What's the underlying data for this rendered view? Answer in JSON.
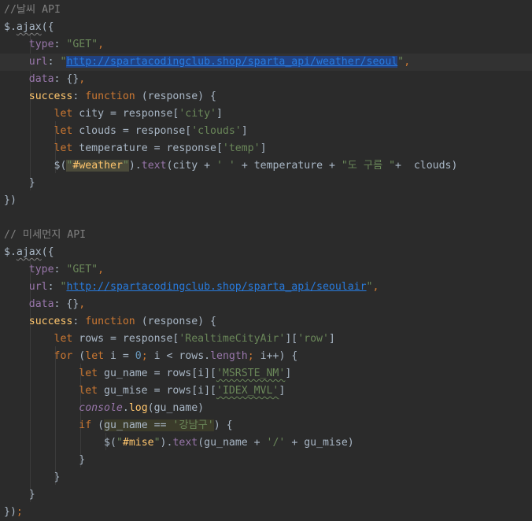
{
  "code": {
    "lines": [
      [
        {
          "t": "//날씨 API",
          "c": "comment"
        }
      ],
      [
        {
          "t": "$.",
          "c": "plain"
        },
        {
          "t": "ajax",
          "c": "plain squig-plain"
        },
        {
          "t": "({",
          "c": "plain"
        }
      ],
      [
        {
          "t": "    ",
          "c": "plain"
        },
        {
          "t": "type",
          "c": "prop"
        },
        {
          "t": ": ",
          "c": "plain"
        },
        {
          "t": "\"GET\"",
          "c": "str"
        },
        {
          "t": ",",
          "c": "kw"
        }
      ],
      [
        {
          "t": "    ",
          "c": "plain"
        },
        {
          "t": "url",
          "c": "prop"
        },
        {
          "t": ": ",
          "c": "plain"
        },
        {
          "t": "\"",
          "c": "str"
        },
        {
          "t": "http://spartacodingclub.shop/sparta_api/weather/seoul",
          "c": "url selected"
        },
        {
          "t": "\"",
          "c": "str"
        },
        {
          "t": ",",
          "c": "kw"
        }
      ],
      [
        {
          "t": "    ",
          "c": "plain"
        },
        {
          "t": "data",
          "c": "prop"
        },
        {
          "t": ": {}",
          "c": "plain"
        },
        {
          "t": ",",
          "c": "kw"
        }
      ],
      [
        {
          "t": "    ",
          "c": "plain"
        },
        {
          "t": "success",
          "c": "succ"
        },
        {
          "t": ": ",
          "c": "plain"
        },
        {
          "t": "function",
          "c": "kw"
        },
        {
          "t": " (response) {",
          "c": "plain"
        }
      ],
      [
        {
          "t": "        ",
          "c": "plain"
        },
        {
          "t": "let",
          "c": "kw"
        },
        {
          "t": " city = response[",
          "c": "plain"
        },
        {
          "t": "'city'",
          "c": "str"
        },
        {
          "t": "]",
          "c": "plain"
        }
      ],
      [
        {
          "t": "        ",
          "c": "plain"
        },
        {
          "t": "let",
          "c": "kw"
        },
        {
          "t": " clouds = response[",
          "c": "plain"
        },
        {
          "t": "'clouds'",
          "c": "str"
        },
        {
          "t": "]",
          "c": "plain"
        }
      ],
      [
        {
          "t": "        ",
          "c": "plain"
        },
        {
          "t": "let",
          "c": "kw"
        },
        {
          "t": " temperature = response[",
          "c": "plain"
        },
        {
          "t": "'temp'",
          "c": "str"
        },
        {
          "t": "]",
          "c": "plain"
        }
      ],
      [
        {
          "t": "        ",
          "c": "plain"
        },
        {
          "t": "$(",
          "c": "plain"
        },
        {
          "t": "\"",
          "c": "str hl-sel"
        },
        {
          "t": "#weather",
          "c": "succ hl-sel"
        },
        {
          "t": "\"",
          "c": "str hl-sel"
        },
        {
          "t": ").",
          "c": "plain"
        },
        {
          "t": "text",
          "c": "prop"
        },
        {
          "t": "(city + ",
          "c": "plain"
        },
        {
          "t": "' '",
          "c": "str"
        },
        {
          "t": " + temperature + ",
          "c": "plain"
        },
        {
          "t": "\"도 구름 \"",
          "c": "str"
        },
        {
          "t": "+  clouds)",
          "c": "plain"
        }
      ],
      [
        {
          "t": "    }",
          "c": "plain"
        }
      ],
      [
        {
          "t": "})",
          "c": "plain"
        }
      ],
      [],
      [
        {
          "t": "// 미세먼지 API",
          "c": "comment"
        }
      ],
      [
        {
          "t": "$.",
          "c": "plain"
        },
        {
          "t": "ajax",
          "c": "plain squig-plain"
        },
        {
          "t": "({",
          "c": "plain"
        }
      ],
      [
        {
          "t": "    ",
          "c": "plain"
        },
        {
          "t": "type",
          "c": "prop"
        },
        {
          "t": ": ",
          "c": "plain"
        },
        {
          "t": "\"GET\"",
          "c": "str"
        },
        {
          "t": ",",
          "c": "kw"
        }
      ],
      [
        {
          "t": "    ",
          "c": "plain"
        },
        {
          "t": "url",
          "c": "prop"
        },
        {
          "t": ": ",
          "c": "plain"
        },
        {
          "t": "\"",
          "c": "str"
        },
        {
          "t": "http://spartacodingclub.shop/sparta_api/seoulair",
          "c": "url"
        },
        {
          "t": "\"",
          "c": "str"
        },
        {
          "t": ",",
          "c": "kw"
        }
      ],
      [
        {
          "t": "    ",
          "c": "plain"
        },
        {
          "t": "data",
          "c": "prop"
        },
        {
          "t": ": {}",
          "c": "plain"
        },
        {
          "t": ",",
          "c": "kw"
        }
      ],
      [
        {
          "t": "    ",
          "c": "plain"
        },
        {
          "t": "success",
          "c": "succ"
        },
        {
          "t": ": ",
          "c": "plain"
        },
        {
          "t": "function",
          "c": "kw"
        },
        {
          "t": " (response) {",
          "c": "plain"
        }
      ],
      [
        {
          "t": "        ",
          "c": "plain"
        },
        {
          "t": "let",
          "c": "kw"
        },
        {
          "t": " rows = response[",
          "c": "plain"
        },
        {
          "t": "'RealtimeCityAir'",
          "c": "str"
        },
        {
          "t": "][",
          "c": "plain"
        },
        {
          "t": "'row'",
          "c": "str"
        },
        {
          "t": "]",
          "c": "plain"
        }
      ],
      [
        {
          "t": "        ",
          "c": "plain"
        },
        {
          "t": "for",
          "c": "kw"
        },
        {
          "t": " (",
          "c": "plain"
        },
        {
          "t": "let",
          "c": "kw"
        },
        {
          "t": " i = ",
          "c": "plain"
        },
        {
          "t": "0",
          "c": "num"
        },
        {
          "t": "; ",
          "c": "kw"
        },
        {
          "t": "i < rows.",
          "c": "plain"
        },
        {
          "t": "length",
          "c": "prop"
        },
        {
          "t": "; ",
          "c": "kw"
        },
        {
          "t": "i++) {",
          "c": "plain"
        }
      ],
      [
        {
          "t": "            ",
          "c": "plain"
        },
        {
          "t": "let",
          "c": "kw"
        },
        {
          "t": " gu_name = rows[i][",
          "c": "plain"
        },
        {
          "t": "'MSRSTE_NM'",
          "c": "str squig"
        },
        {
          "t": "]",
          "c": "plain"
        }
      ],
      [
        {
          "t": "            ",
          "c": "plain"
        },
        {
          "t": "let",
          "c": "kw"
        },
        {
          "t": " gu_mise = rows[i][",
          "c": "plain"
        },
        {
          "t": "'IDEX_MVL'",
          "c": "str squig"
        },
        {
          "t": "]",
          "c": "plain"
        }
      ],
      [
        {
          "t": "            ",
          "c": "plain"
        },
        {
          "t": "console",
          "c": "fn-italic"
        },
        {
          "t": ".",
          "c": "plain"
        },
        {
          "t": "log",
          "c": "fn"
        },
        {
          "t": "(gu_name)",
          "c": "plain"
        }
      ],
      [
        {
          "t": "            ",
          "c": "plain"
        },
        {
          "t": "if",
          "c": "kw"
        },
        {
          "t": " (",
          "c": "plain"
        },
        {
          "t": "gu_name == ",
          "c": "plain hl-match"
        },
        {
          "t": "'강남구'",
          "c": "str hl-match"
        },
        {
          "t": ") {",
          "c": "plain"
        }
      ],
      [
        {
          "t": "                ",
          "c": "plain"
        },
        {
          "t": "$(",
          "c": "plain"
        },
        {
          "t": "\"",
          "c": "str"
        },
        {
          "t": "#mise",
          "c": "succ"
        },
        {
          "t": "\"",
          "c": "str"
        },
        {
          "t": ").",
          "c": "plain"
        },
        {
          "t": "text",
          "c": "prop"
        },
        {
          "t": "(gu_name + ",
          "c": "plain"
        },
        {
          "t": "'/'",
          "c": "str"
        },
        {
          "t": " + gu_mise)",
          "c": "plain"
        }
      ],
      [
        {
          "t": "            }",
          "c": "plain"
        }
      ],
      [
        {
          "t": "        }",
          "c": "plain"
        }
      ],
      [
        {
          "t": "    }",
          "c": "plain"
        }
      ],
      [
        {
          "t": "})",
          "c": "plain"
        },
        {
          "t": ";",
          "c": "kw"
        }
      ]
    ],
    "current_line": 3
  }
}
